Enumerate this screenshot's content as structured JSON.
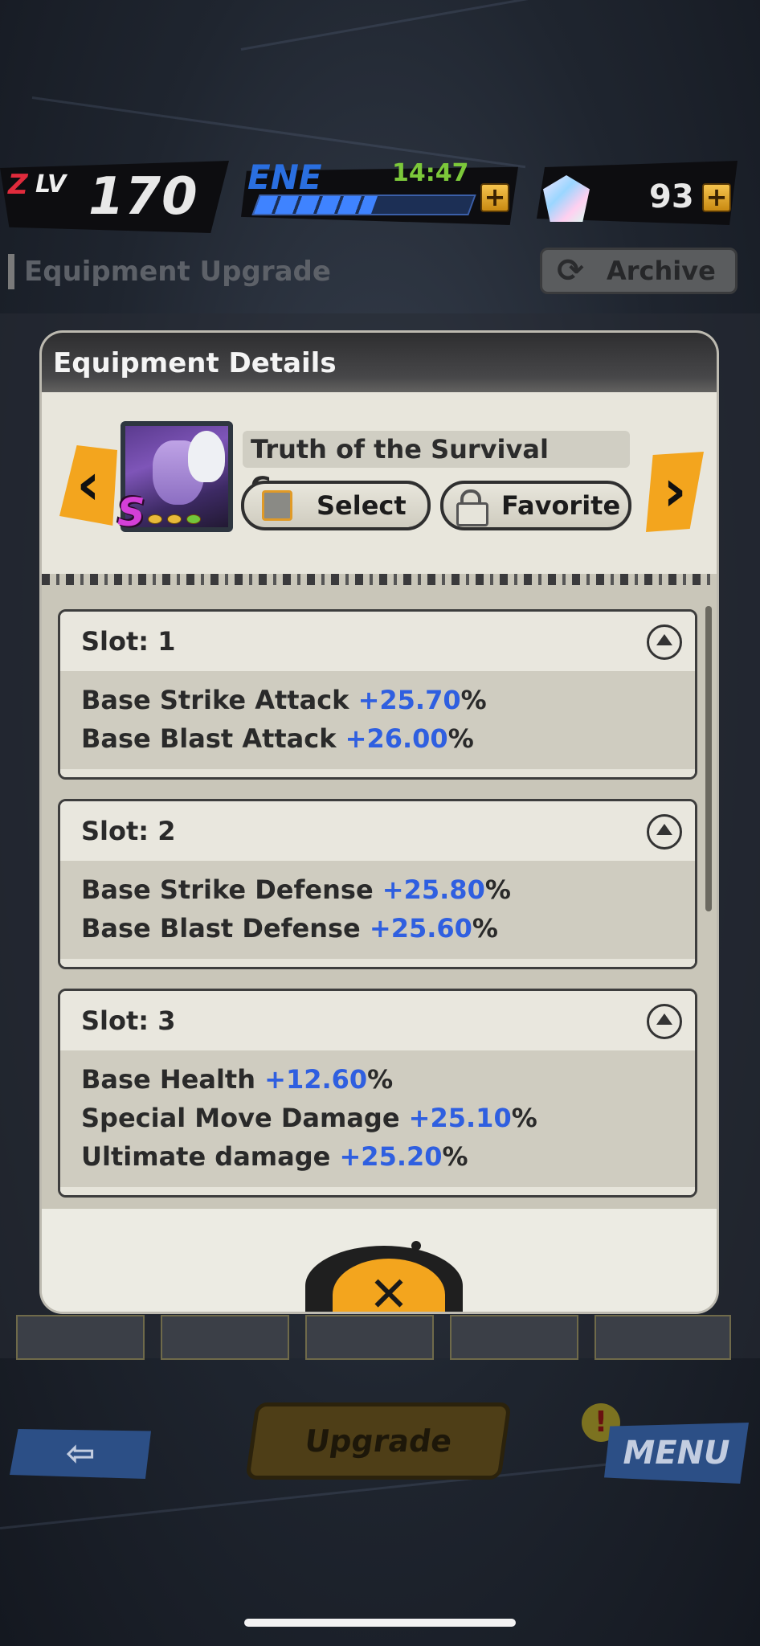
{
  "hud": {
    "rank_prefix": "Z",
    "rank_label": "LV",
    "rank": "170",
    "energy_label": "ENE",
    "energy_timer": "14:47",
    "energy_fill": 0.55,
    "plus": "+",
    "stones": "93"
  },
  "page": {
    "title": "Equipment Upgrade",
    "archive_label": "Archive",
    "upgrade_label": "Upgrade",
    "menu_label": "MENU",
    "back_icon": "back-arrow-icon"
  },
  "modal": {
    "title": "Equipment Details",
    "equipment_name": "Truth of the Survival Game",
    "rarity": "S",
    "select_label": "Select",
    "favorite_label": "Favorite",
    "prev_arrow": "‹",
    "next_arrow": "›",
    "close": "✕",
    "slots": [
      {
        "title": "Slot: 1",
        "stats": [
          {
            "name": "Base Strike Attack ",
            "value": "+25.70",
            "unit": "%"
          },
          {
            "name": "Base Blast Attack ",
            "value": "+26.00",
            "unit": "%"
          }
        ]
      },
      {
        "title": "Slot: 2",
        "stats": [
          {
            "name": "Base Strike Defense ",
            "value": "+25.80",
            "unit": "%"
          },
          {
            "name": "Base Blast Defense ",
            "value": "+25.60",
            "unit": "%"
          }
        ]
      },
      {
        "title": "Slot: 3",
        "stats": [
          {
            "name": "Base Health ",
            "value": "+12.60",
            "unit": "%"
          },
          {
            "name": "Special Move Damage ",
            "value": "+25.10",
            "unit": "%"
          },
          {
            "name": "Ultimate damage ",
            "value": "+25.20",
            "unit": "%"
          }
        ]
      }
    ]
  },
  "colors": {
    "accent_orange": "#f3a51e",
    "stat_value_blue": "#2f5fe0",
    "energy_blue": "#3f83ff",
    "timer_green": "#7cc83a",
    "rarity_purple": "#d43fd8"
  }
}
